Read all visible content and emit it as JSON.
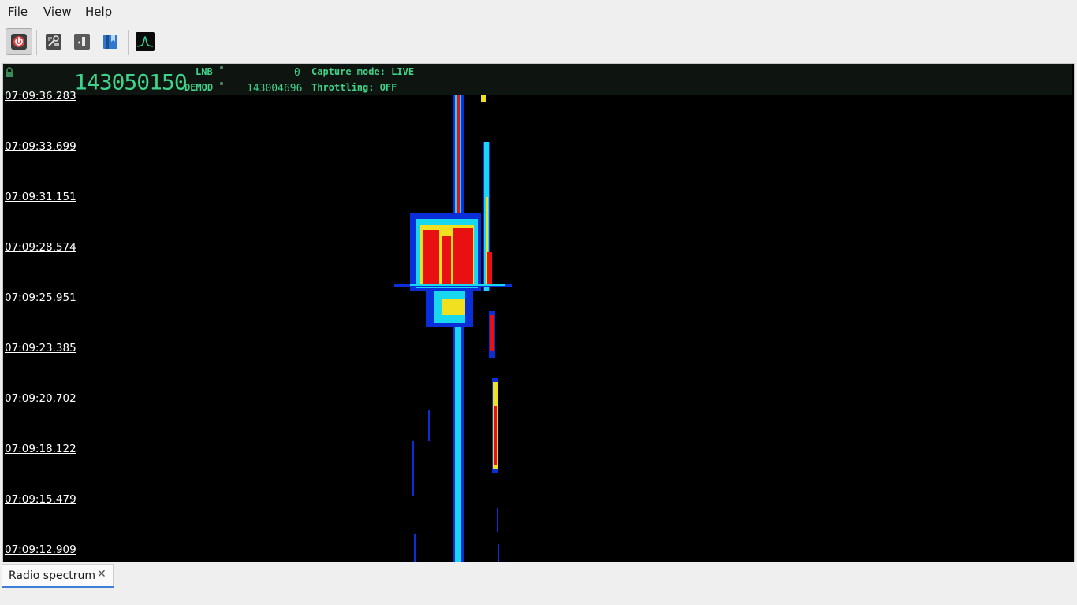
{
  "menu": {
    "file": "File",
    "view": "View",
    "help": "Help"
  },
  "toolbar": {
    "buttons": [
      {
        "name": "power-icon",
        "pressed": true
      },
      {
        "name": "settings-tool-icon",
        "pressed": false
      },
      {
        "name": "record-icon",
        "pressed": false
      },
      {
        "name": "bookmark-icon",
        "pressed": false
      },
      {
        "name": "spectrum-peak-icon",
        "pressed": false
      }
    ]
  },
  "freq_header": {
    "main_frequency": "143050150",
    "lnb_label": "LNB",
    "lnb_value": "0",
    "demod_label": "DEMOD",
    "demod_value": "143004696",
    "capture_mode": "Capture mode: LIVE",
    "throttling": "Throttling: OFF"
  },
  "waterfall": {
    "timestamps": [
      "07:09:36.283",
      "07:09:33.699",
      "07:09:31.151",
      "07:09:28.574",
      "07:09:25.951",
      "07:09:23.385",
      "07:09:20.702",
      "07:09:18.122",
      "07:09:15.479",
      "07:09:12.909"
    ],
    "colors": {
      "background": "#000000",
      "weak": "#0a2fd8",
      "mid": "#18d8f0",
      "strong": "#f0e020",
      "peak": "#e81010"
    }
  },
  "tabs": [
    {
      "label": "Radio spectrum",
      "close": "✕"
    }
  ]
}
